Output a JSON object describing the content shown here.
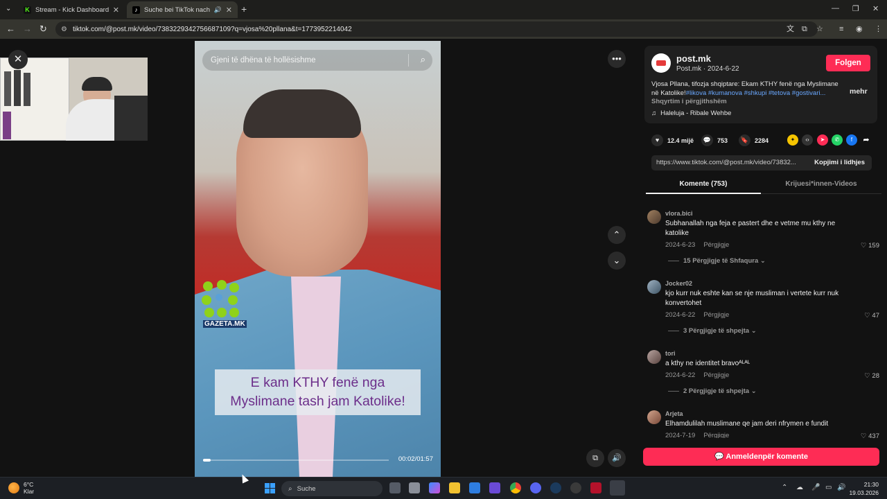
{
  "browser": {
    "tabs": [
      {
        "title": "Stream - Kick Dashboard",
        "favicon": "kick-icon"
      },
      {
        "title": "Suche bei TikTok nach 'vjosa",
        "favicon": "tiktok-icon"
      }
    ],
    "url": "tiktok.com/@post.mk/video/7383229342756687109?q=vjosa%20pllana&t=1773952214042"
  },
  "video": {
    "search_placeholder": "Gjeni të dhëna të hollësishme",
    "logo_text": "GAZETA.MK",
    "caption_line1": "E kam KTHY fenë nga",
    "caption_line2": "Myslimane tash jam Katolike!",
    "time": "00:02/01:57",
    "progress": 0.017
  },
  "author": {
    "name": "post.mk",
    "sub": "Post.mk · 2024-6-22",
    "follow_label": "Folgen",
    "desc_text": "Vjosa Pllana, tifozja shqiptare: Ekam KTHY fenë nga Myslimane në Katolike!",
    "desc_tags": "#likova #kumanova #shkupi #tetova #gostivari...",
    "more_label": "mehr",
    "translate_label": "Shqyrtim i përgjithshëm",
    "music": "Haleluja - Ribale Wehbe"
  },
  "actions": {
    "likes": "12.4 mijë",
    "comments": "753",
    "saves": "2284"
  },
  "link": {
    "url": "https://www.tiktok.com/@post.mk/video/73832...",
    "copy_label": "Kopjimi i lidhjes"
  },
  "tabs": {
    "comments": "Komente (753)",
    "creator": "Krijuesi*innen-Videos"
  },
  "comments": [
    {
      "user": "vlora.bici",
      "text": "Subhanallah nga feja e pastert dhe e vetme mu kthy ne katolike",
      "date": "2024-6-23",
      "reply": "Përgjigje",
      "likes": "159",
      "replies": "15 Përgjigje të Shfaqura"
    },
    {
      "user": "Jocker02",
      "text": "kjo kurr nuk eshte kan se nje musliman i vertete kurr nuk konvertohet",
      "date": "2024-6-22",
      "reply": "Përgjigje",
      "likes": "47",
      "replies": "3 Përgjigje të shpejta"
    },
    {
      "user": "tori",
      "text": "a kthy ne identitet bravoᴬᴸᴬᴸ",
      "date": "2024-6-22",
      "reply": "Përgjigje",
      "likes": "28",
      "replies": "2 Përgjigje të shpejta"
    },
    {
      "user": "Arjeta",
      "text": "Elhamdulilah muslimane qe jam deri nfrymen e fundit",
      "date": "2024-7-19",
      "reply": "Përgjigje",
      "likes": "437",
      "replies": ""
    }
  ],
  "login_comment": "Anmeldenpër komente",
  "taskbar": {
    "temp": "6°C",
    "weather": "Klar",
    "search": "Suche",
    "time": "21:30",
    "date": "19.03.2026"
  }
}
